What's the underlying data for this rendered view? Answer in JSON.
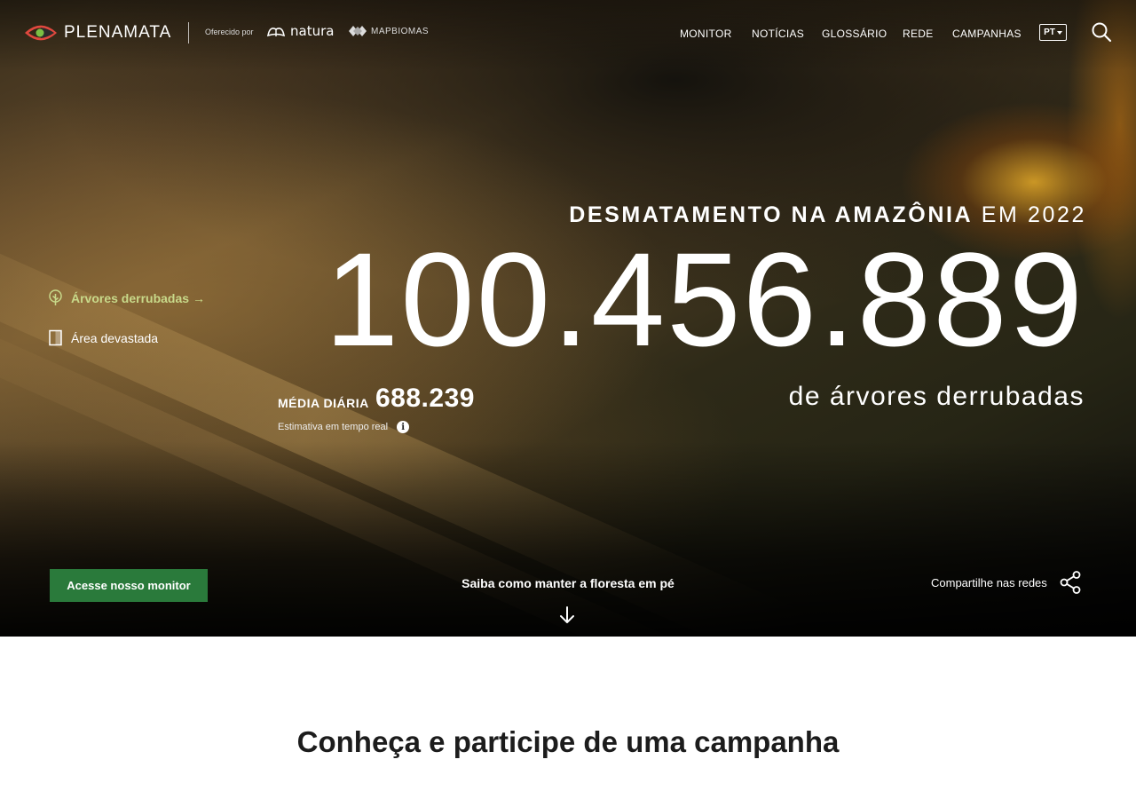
{
  "header": {
    "brand": "PLENAMATA",
    "offered_by": "Oferecido por",
    "partners": {
      "natura": "natura",
      "mapbiomas": "MAPBIOMAS"
    },
    "nav": [
      {
        "label": "MONITOR"
      },
      {
        "label": "NOTÍCIAS"
      },
      {
        "label": "GLOSSÁRIO"
      },
      {
        "label": "REDE"
      },
      {
        "label": "CAMPANHAS"
      }
    ],
    "language": "PT",
    "icons": {
      "search": "search-icon",
      "language_caret": "chevron-down-icon"
    }
  },
  "sidebar_toggles": [
    {
      "label": "Árvores derrubadas →",
      "icon": "tree-icon",
      "active": true
    },
    {
      "label": "Área devastada",
      "icon": "area-icon",
      "active": false
    }
  ],
  "counter": {
    "kicker_bold": "DESMATAMENTO NA AMAZÔNIA",
    "kicker_light": " EM 2022",
    "value": "100.456.889",
    "unit_text": "de árvores derrubadas",
    "daily_label": "MÉDIA DIÁRIA",
    "daily_value": "688.239",
    "estimate_label": "Estimativa em tempo real",
    "info_icon": "i"
  },
  "bottom_bar": {
    "cta_label": "Acesse nosso monitor",
    "learn_label": "Saiba como manter a floresta em pé",
    "share_label": "Compartilhe nas redes"
  },
  "section": {
    "title": "Conheça e participe de uma campanha"
  },
  "colors": {
    "accent_green": "#2a7a3b",
    "active_toggle": "#c8d98a",
    "logo_red": "#e0483e",
    "logo_green": "#7bbf44"
  }
}
